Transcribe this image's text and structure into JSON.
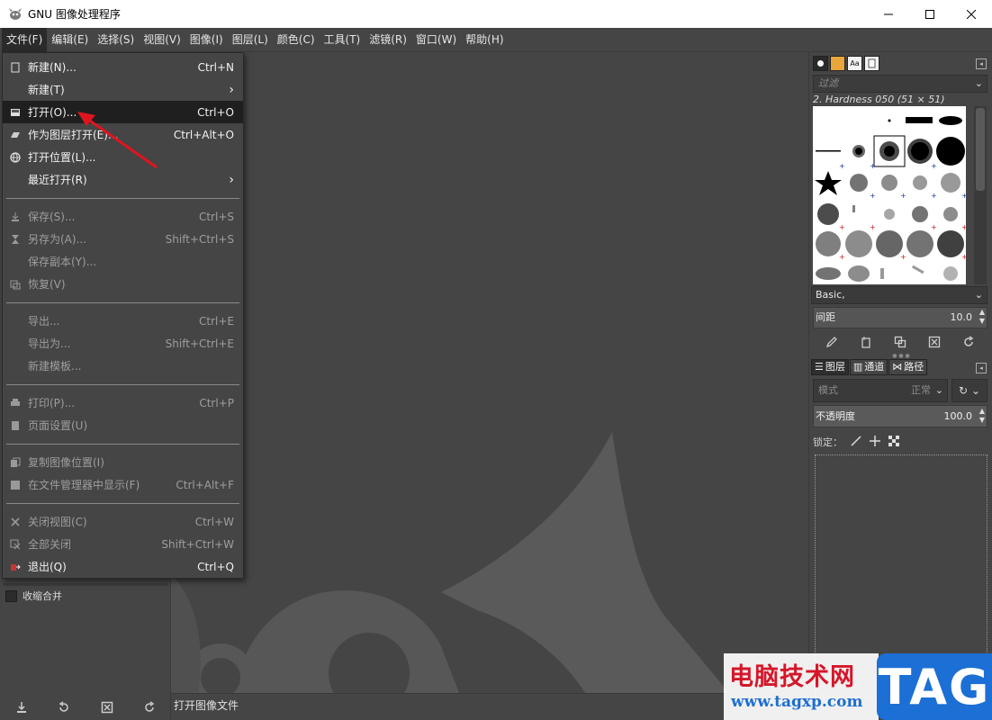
{
  "window": {
    "title": "GNU 图像处理程序",
    "minimize_label": "—",
    "maximize_label": "☐",
    "close_label": "✕"
  },
  "menubar": {
    "items": [
      "文件(F)",
      "编辑(E)",
      "选择(S)",
      "视图(V)",
      "图像(I)",
      "图层(L)",
      "颜色(C)",
      "工具(T)",
      "滤镜(R)",
      "窗口(W)",
      "帮助(H)"
    ],
    "active_index": 0
  },
  "file_menu": {
    "groups": [
      [
        {
          "label": "新建(N)...",
          "shortcut": "Ctrl+N",
          "icon": "new-icon",
          "enabled": true
        },
        {
          "label": "新建(T)",
          "shortcut": "",
          "submenu": true,
          "icon": "",
          "enabled": true
        },
        {
          "label": "打开(O)...",
          "shortcut": "Ctrl+O",
          "icon": "open-icon",
          "enabled": true,
          "hover": true
        },
        {
          "label": "作为图层打开(E)...",
          "shortcut": "Ctrl+Alt+O",
          "icon": "open-as-layer-icon",
          "enabled": true
        },
        {
          "label": "打开位置(L)...",
          "shortcut": "",
          "icon": "globe-icon",
          "enabled": true
        },
        {
          "label": "最近打开(R)",
          "shortcut": "",
          "submenu": true,
          "icon": "",
          "enabled": true
        }
      ],
      [
        {
          "label": "保存(S)...",
          "shortcut": "Ctrl+S",
          "icon": "save-icon",
          "enabled": false
        },
        {
          "label": "另存为(A)...",
          "shortcut": "Shift+Ctrl+S",
          "icon": "save-as-icon",
          "enabled": false
        },
        {
          "label": "保存副本(Y)...",
          "shortcut": "",
          "icon": "",
          "enabled": false
        },
        {
          "label": "恢复(V)",
          "shortcut": "",
          "icon": "revert-icon",
          "enabled": false
        }
      ],
      [
        {
          "label": "导出...",
          "shortcut": "Ctrl+E",
          "icon": "",
          "enabled": false
        },
        {
          "label": "导出为...",
          "shortcut": "Shift+Ctrl+E",
          "icon": "",
          "enabled": false
        },
        {
          "label": "新建模板...",
          "shortcut": "",
          "icon": "",
          "enabled": false
        }
      ],
      [
        {
          "label": "打印(P)...",
          "shortcut": "Ctrl+P",
          "icon": "print-icon",
          "enabled": false
        },
        {
          "label": "页面设置(U)",
          "shortcut": "",
          "icon": "page-setup-icon",
          "enabled": false
        }
      ],
      [
        {
          "label": "复制图像位置(I)",
          "shortcut": "",
          "icon": "copy-location-icon",
          "enabled": false
        },
        {
          "label": "在文件管理器中显示(F)",
          "shortcut": "Ctrl+Alt+F",
          "icon": "file-manager-icon",
          "enabled": false
        }
      ],
      [
        {
          "label": "关闭视图(C)",
          "shortcut": "Ctrl+W",
          "icon": "close-view-icon",
          "enabled": false
        },
        {
          "label": "全部关闭",
          "shortcut": "Shift+Ctrl+W",
          "icon": "close-all-icon",
          "enabled": false
        },
        {
          "label": "退出(Q)",
          "shortcut": "Ctrl+Q",
          "icon": "quit-icon",
          "enabled": true
        }
      ]
    ]
  },
  "left_dock": {
    "merge_label": "收缩合并"
  },
  "status": {
    "text": "打开图像文件"
  },
  "brushes": {
    "filter_placeholder": "过滤",
    "selected_brush": "2. Hardness 050 (51 × 51)",
    "preset": "Basic,",
    "spacing_label": "间距",
    "spacing_value": "10.0"
  },
  "layers": {
    "tabs": [
      "图层",
      "通道",
      "路径"
    ],
    "mode_label": "模式",
    "mode_value": "正常",
    "opacity_label": "不透明度",
    "opacity_value": "100.0",
    "lock_label": "锁定："
  },
  "watermark": {
    "title": "电脑技术网",
    "url": "www.tagxp.com",
    "tag": "TAG"
  },
  "colors": {
    "background": "#454545",
    "menu_hover": "#1f1f1f",
    "arrow": "#e0141e",
    "watermark_red": "#d6162a",
    "watermark_blue": "#1c6fd4"
  }
}
